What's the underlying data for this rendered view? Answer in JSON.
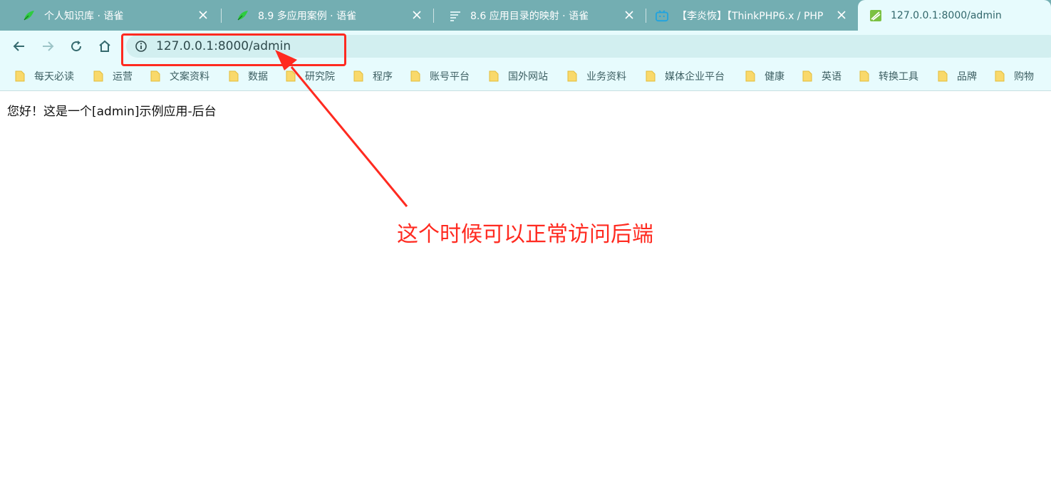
{
  "tabs": [
    {
      "title": "个人知识库 · 语雀",
      "icon": "yuque-bird-icon"
    },
    {
      "title": "8.9 多应用案例 · 语雀",
      "icon": "yuque-bird-icon"
    },
    {
      "title": "8.6 应用目录的映射 · 语雀",
      "icon": "doc-lines-icon"
    },
    {
      "title": "【李炎恢】【ThinkPHP6.x / PHP",
      "icon": "bilibili-tv-icon"
    },
    {
      "title": "127.0.0.1:8000/admin",
      "icon": "site-favicon-icon"
    }
  ],
  "toolbar": {
    "url": "127.0.0.1:8000/admin",
    "back_icon": "arrow-left-icon",
    "forward_icon": "arrow-right-icon",
    "reload_icon": "reload-icon",
    "home_icon": "home-icon",
    "site_info_icon": "info-icon"
  },
  "bookmarks": [
    {
      "label": "每天必读"
    },
    {
      "label": "运营"
    },
    {
      "label": "文案资料"
    },
    {
      "label": "数据"
    },
    {
      "label": "研究院"
    },
    {
      "label": "程序"
    },
    {
      "label": "账号平台"
    },
    {
      "label": "国外网站"
    },
    {
      "label": "业务资料"
    },
    {
      "label": "媒体企业平台"
    },
    {
      "label": "健康"
    },
    {
      "label": "英语"
    },
    {
      "label": "转换工具"
    },
    {
      "label": "品牌"
    },
    {
      "label": "购物"
    }
  ],
  "page": {
    "body_text": "您好！这是一个[admin]示例应用-后台"
  },
  "annotation": {
    "text": "这个时候可以正常访问后端"
  },
  "colors": {
    "tabstrip": "#73aeb2",
    "toolbar": "#e7fbfd",
    "omnibox": "#d2eff0",
    "annotation": "#ff2a20",
    "folder": "#f9d96b"
  }
}
